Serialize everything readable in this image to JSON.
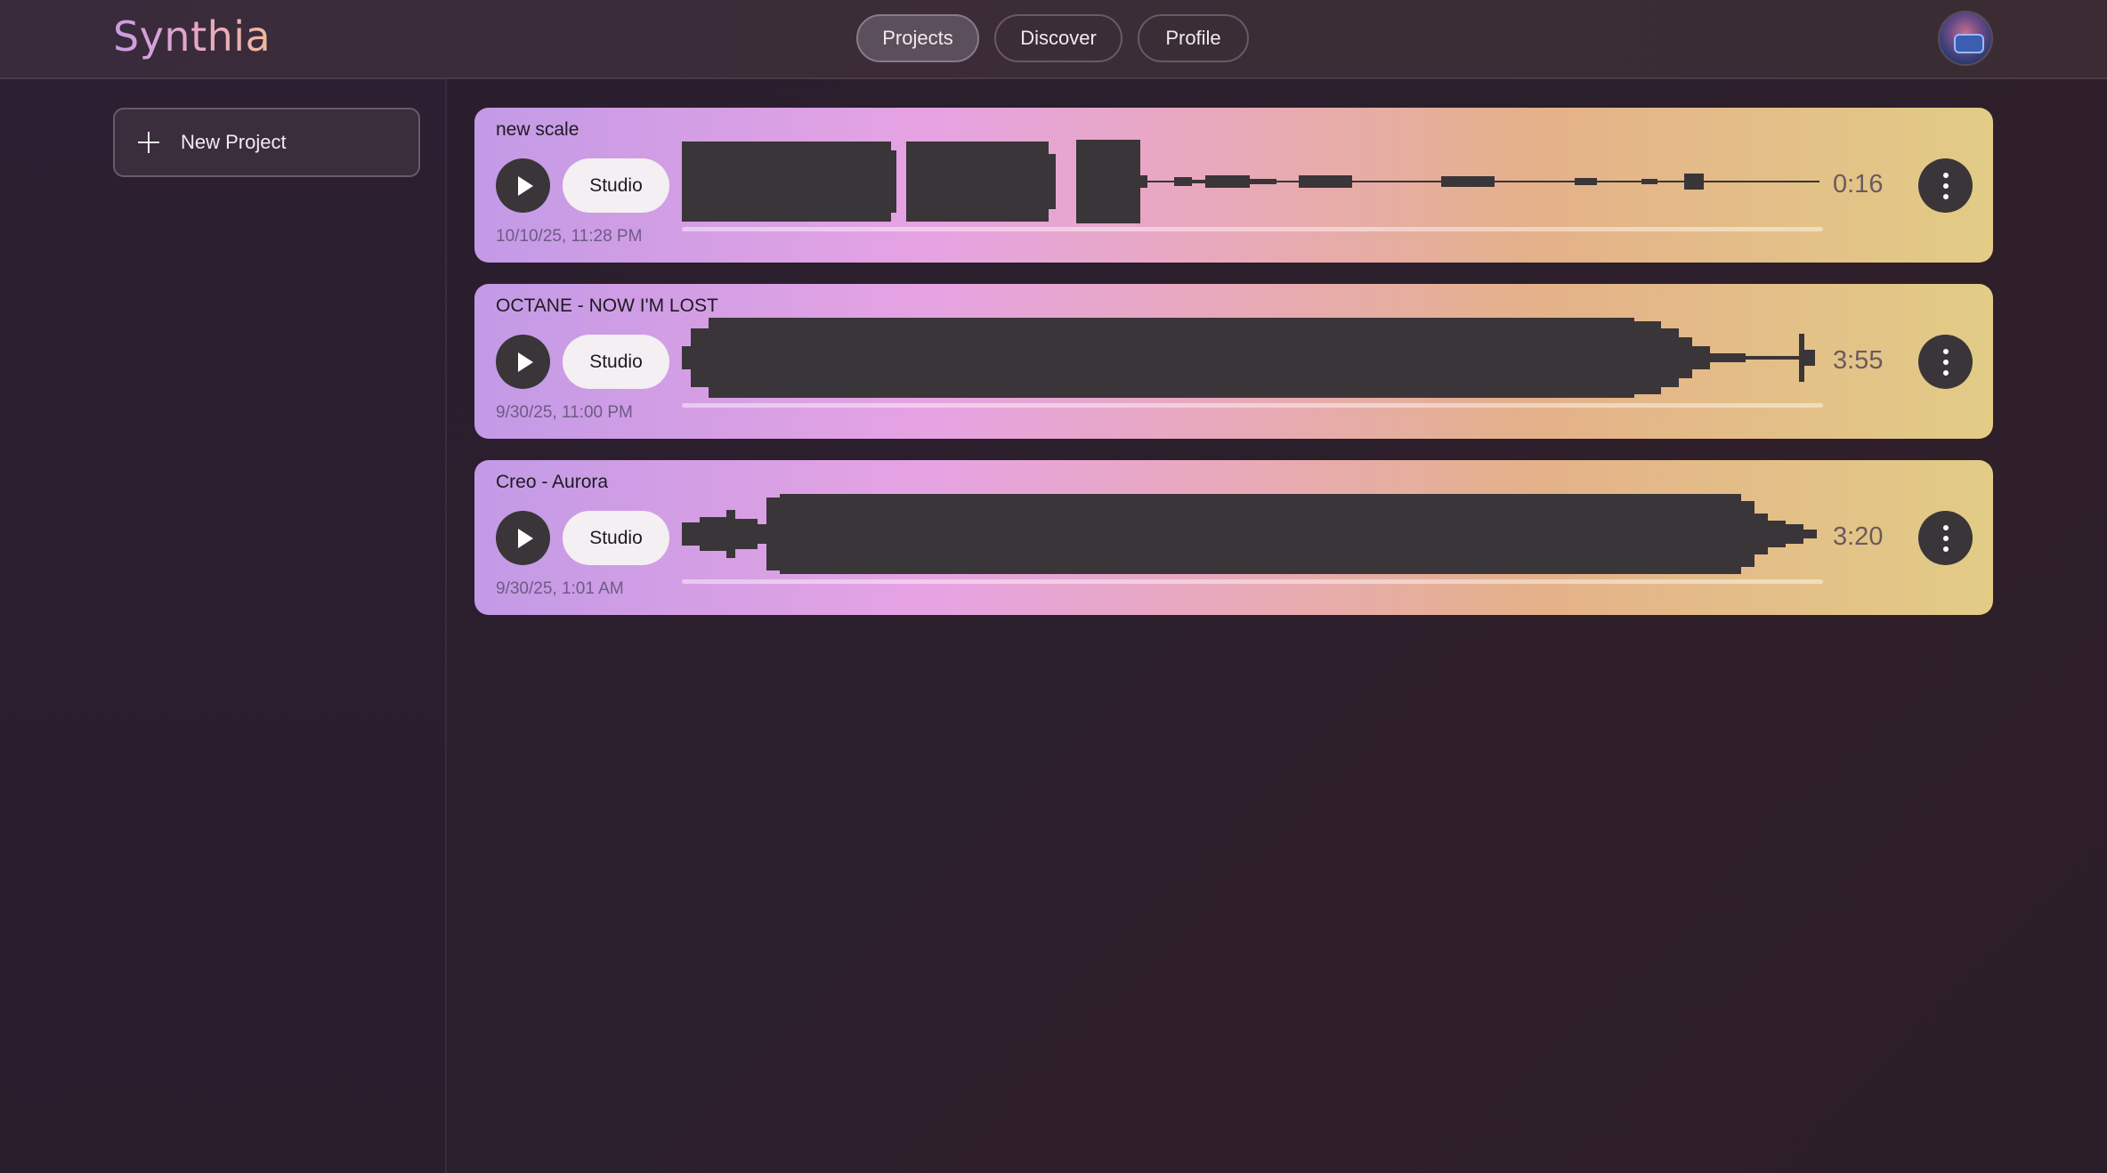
{
  "app": {
    "title": "Synthia"
  },
  "nav": {
    "tabs": [
      {
        "label": "Projects",
        "active": true
      },
      {
        "label": "Discover",
        "active": false
      },
      {
        "label": "Profile",
        "active": false
      }
    ]
  },
  "sidebar": {
    "new_project_label": "New Project"
  },
  "projects": [
    {
      "title": "new scale",
      "studio_label": "Studio",
      "date": "10/10/25, 11:28 PM",
      "duration": "0:16"
    },
    {
      "title": "OCTANE - NOW I'M LOST",
      "studio_label": "Studio",
      "date": "9/30/25, 11:00 PM",
      "duration": "3:55"
    },
    {
      "title": "Creo - Aurora",
      "studio_label": "Studio",
      "date": "9/30/25, 1:01 AM",
      "duration": "3:20"
    }
  ],
  "colors": {
    "waveform": "#3a3538",
    "card_gradient": [
      "#c39ae6",
      "#e6a3e3",
      "#e8a9b9",
      "#e4b189",
      "#e2cc86"
    ],
    "background": "#2a1e2f"
  }
}
